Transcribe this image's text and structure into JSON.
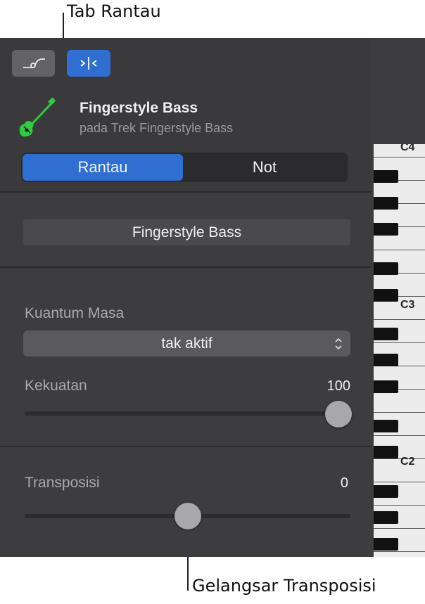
{
  "callouts": {
    "top": "Tab Rantau",
    "bottom": "Gelangsar Transposisi"
  },
  "toolbar": {
    "automation_icon": "automation-curve-icon",
    "region_icon": "region-inspector-icon"
  },
  "track": {
    "icon": "bass-guitar-icon",
    "name": "Fingerstyle Bass",
    "subtitle": "pada Trek Fingerstyle Bass"
  },
  "tabs": {
    "left": "Rantau",
    "right": "Not",
    "selected": "Rantau"
  },
  "region": {
    "name": "Fingerstyle Bass"
  },
  "quantize": {
    "label": "Kuantum Masa",
    "value": "tak aktif"
  },
  "strength": {
    "label": "Kekuatan",
    "value": "100",
    "level_percent": 100
  },
  "transpose": {
    "label": "Transposisi",
    "value": "0",
    "level_percent": 50
  },
  "keyboard": {
    "octaves": [
      "C4",
      "C3",
      "C2"
    ]
  },
  "colors": {
    "accent": "#2f6fd2",
    "panel": "#3d3d3f",
    "bass_icon": "#2ecc40"
  }
}
